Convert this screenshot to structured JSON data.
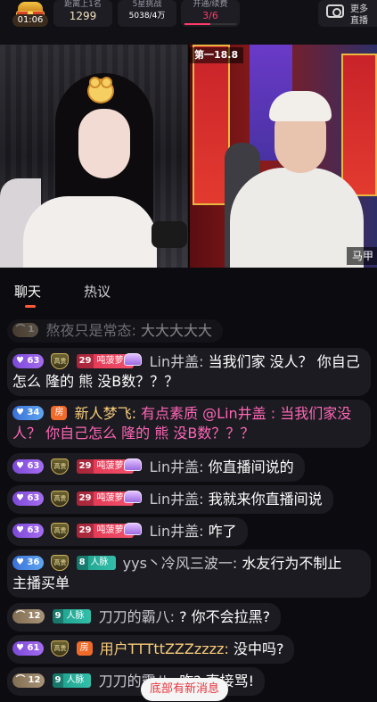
{
  "topbar": {
    "timer": "01:06",
    "stats": [
      {
        "label": "距离上1名",
        "value": "1299"
      },
      {
        "label": "5星挑战",
        "value": "5038/4万"
      },
      {
        "label": "开通/续费",
        "value": "3/6",
        "progress": 0.5
      }
    ],
    "mode": {
      "line1": "更多",
      "line2": "直播"
    }
  },
  "video": {
    "rank_label": "第一18.8",
    "right_name": "马甲"
  },
  "tabs": [
    {
      "label": "聊天",
      "active": true
    },
    {
      "label": "热议",
      "active": false
    }
  ],
  "chat": [
    {
      "level": "1",
      "name": "熬夜只是常态:",
      "text": "大大大大大"
    },
    {
      "level": "63",
      "shield": "高贵",
      "fan_level": "29",
      "fan_name": "吨菠萝",
      "name": "Lin井盖:",
      "text": "当我们家 没人？  你自己怎么 隆的 熊 没B数？？？"
    },
    {
      "level": "34",
      "room": "房",
      "name": "新人梦飞:",
      "text": "有点素质 @Lin井盖 :  当我们家没人？  你自己怎么 隆的 熊 没B数？？？"
    },
    {
      "level": "63",
      "shield": "高贵",
      "fan_level": "29",
      "fan_name": "吨菠萝",
      "name": "Lin井盖:",
      "text": "你直播间说的"
    },
    {
      "level": "63",
      "shield": "高贵",
      "fan_level": "29",
      "fan_name": "吨菠萝",
      "name": "Lin井盖:",
      "text": "我就来你直播间说"
    },
    {
      "level": "63",
      "shield": "高贵",
      "fan_level": "29",
      "fan_name": "吨菠萝",
      "name": "Lin井盖:",
      "text": "咋了"
    },
    {
      "level": "36",
      "shield": "高贵",
      "fan_level": "8",
      "fan_name": "人脉",
      "name": "yys丶冷风三波一:",
      "text": "水友行为不制止 主播买单"
    },
    {
      "level": "12",
      "fan_level": "9",
      "fan_name": "人脉",
      "name": "刀刀的霸八:",
      "text": "? 你不会拉黑?"
    },
    {
      "level": "61",
      "shield": "高贵",
      "room": "房",
      "name": "用户TTTttZZZzzzz:",
      "text": "没中吗?"
    },
    {
      "level": "12",
      "fan_level": "9",
      "fan_name": "人脉",
      "name": "刀刀的霸八:",
      "text": "咋? 直接骂!"
    }
  ],
  "new_message_button": "底部有新消息",
  "colors": {
    "accent": "#ff5a3c",
    "pink_name": "#ff66b7",
    "badge_red": "#e2324d",
    "badge_teal": "#1c9d8c"
  }
}
